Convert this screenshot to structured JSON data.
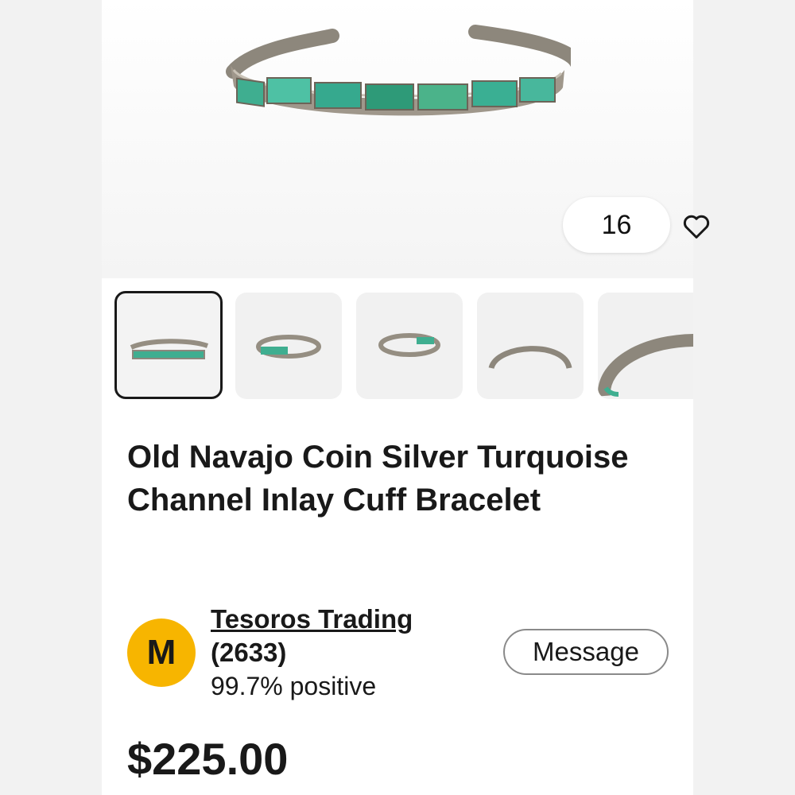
{
  "listing": {
    "favorite_count": "16",
    "title": "Old Navajo Coin Silver Turquoise Channel Inlay Cuff Bracelet",
    "price": "$225.00"
  },
  "seller": {
    "avatar_letter": "M",
    "name": "Tesoros Trading",
    "feedback_count": "(2633)",
    "positive": "99.7% positive",
    "message_label": "Message"
  },
  "thumbnails": {
    "selected_index": 0,
    "count_visible": 5
  },
  "colors": {
    "avatar": "#f7b500",
    "text": "#191919",
    "turquoise": "#3fae90",
    "silver": "#a79f93"
  }
}
